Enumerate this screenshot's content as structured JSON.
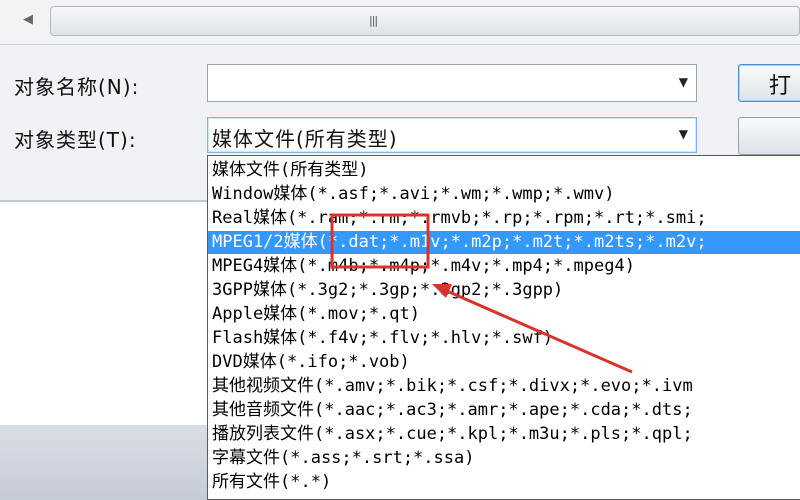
{
  "scrollbar": {
    "left_arrow_icon": "chevron-left-icon",
    "grip_text": "|||"
  },
  "form": {
    "object_name_label": "对象名称(N):",
    "object_type_label": "对象类型(T):",
    "object_name_value": "",
    "object_type_value": "媒体文件(所有类型)",
    "open_button_label": "打",
    "second_button_label": ""
  },
  "dropdown": {
    "selected_index": 3,
    "options": [
      "媒体文件(所有类型)",
      "Window媒体(*.asf;*.avi;*.wm;*.wmp;*.wmv)",
      "Real媒体(*.ram;*.rm;*.rmvb;*.rp;*.rpm;*.rt;*.smi;",
      "MPEG1/2媒体(*.dat;*.m1v;*.m2p;*.m2t;*.m2ts;*.m2v;",
      "MPEG4媒体(*.m4b;*.m4p;*.m4v;*.mp4;*.mpeg4)",
      "3GPP媒体(*.3g2;*.3gp;*.3gp2;*.3gpp)",
      "Apple媒体(*.mov;*.qt)",
      "Flash媒体(*.f4v;*.flv;*.hlv;*.swf)",
      "DVD媒体(*.ifo;*.vob)",
      "其他视频文件(*.amv;*.bik;*.csf;*.divx;*.evo;*.ivm",
      "其他音频文件(*.aac;*.ac3;*.amr;*.ape;*.cda;*.dts;",
      "播放列表文件(*.asx;*.cue;*.kpl;*.m3u;*.pls;*.qpl;",
      "字幕文件(*.ass;*.srt;*.ssa)",
      "所有文件(*.*)"
    ]
  },
  "annotation": {
    "color": "#d9342b",
    "highlight_target": "*.dat"
  },
  "colors": {
    "selection": "#3399ff",
    "focus_border": "#7eb4ea"
  }
}
